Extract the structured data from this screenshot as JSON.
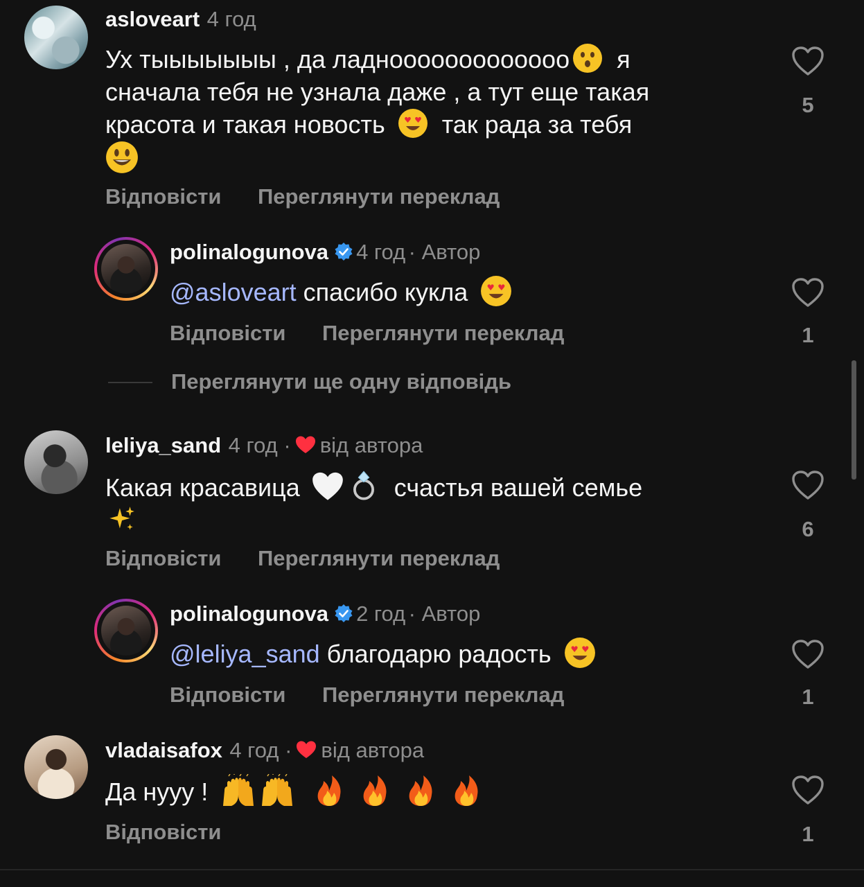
{
  "comments": [
    {
      "username": "asloveart",
      "time": "4 год",
      "text_line1": "Ух тыыыыыыы , да ладнооооооооооооо",
      "text_line1_tail": " я",
      "text_line2": "сначала тебя не узнала даже , а тут еще такая",
      "text_line3": "красота и такая новость",
      "text_line3_tail": " так рада за тебя",
      "reply": "Відповісти",
      "translate": "Переглянути переклад",
      "likes": "5",
      "emojis": [
        "hushed-face",
        "heart-eyes",
        "smiley"
      ]
    },
    {
      "username": "polinalogunova",
      "time": "4 год",
      "author": "· Автор",
      "mention": "@asloveart",
      "text": " спасибо кукла",
      "reply": "Відповісти",
      "translate": "Переглянути переклад",
      "likes": "1"
    },
    {
      "view_more": "Переглянути ще одну відповідь"
    },
    {
      "username": "leliya_sand",
      "time": "4 год ·",
      "by_author": "від автора",
      "text": "Какая красавица",
      "text_tail": " счастья вашей семье",
      "reply": "Відповісти",
      "translate": "Переглянути переклад",
      "likes": "6",
      "emojis": [
        "white-heart",
        "ring",
        "sparkles"
      ]
    },
    {
      "username": "polinalogunova",
      "time": "2 год",
      "author": "· Автор",
      "mention": "@leliya_sand",
      "text": " благодарю радость",
      "reply": "Відповісти",
      "translate": "Переглянути переклад",
      "likes": "1"
    },
    {
      "username": "vladaisafox",
      "time": "4 год ·",
      "by_author": "від автора",
      "text": "Да нууу !",
      "reply": "Відповісти",
      "likes": "1",
      "emojis": [
        "raising-hands",
        "raising-hands",
        "fire",
        "fire",
        "fire",
        "fire"
      ]
    }
  ],
  "colors": {
    "background": "#121212",
    "text": "#f5f5f5",
    "muted": "#8e8e8e",
    "mention": "#a6b8ff",
    "verified": "#3897f0",
    "red_heart": "#ff3040"
  }
}
